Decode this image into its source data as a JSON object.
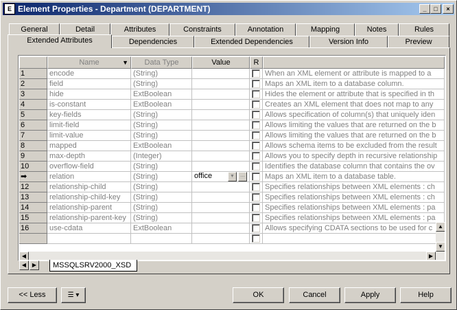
{
  "window": {
    "app_icon": "E",
    "title": "Element Properties - Department (DEPARTMENT)",
    "minimize_glyph": "_",
    "maximize_glyph": "□",
    "close_glyph": "×"
  },
  "tabs_row1": [
    "General",
    "Detail",
    "Attributes",
    "Constraints",
    "Annotation",
    "Mapping",
    "Notes",
    "Rules"
  ],
  "tabs_row2": [
    "Extended Attributes",
    "Dependencies",
    "Extended Dependencies",
    "Version Info",
    "Preview"
  ],
  "active_tab": "Extended Attributes",
  "grid": {
    "headers": {
      "name": "Name",
      "data_type": "Data Type",
      "value": "Value",
      "r": "R"
    },
    "rows": [
      {
        "num": "1",
        "name": "encode",
        "type": "(String)",
        "value": "",
        "desc": "When an XML element or attribute is mapped to a"
      },
      {
        "num": "2",
        "name": "field",
        "type": "(String)",
        "value": "",
        "desc": "Maps an XML item to a database column."
      },
      {
        "num": "3",
        "name": "hide",
        "type": "ExtBoolean",
        "value": "",
        "desc": "Hides the element or attribute that is specified in th"
      },
      {
        "num": "4",
        "name": "is-constant",
        "type": "ExtBoolean",
        "value": "",
        "desc": "Creates an XML element that does not map to any"
      },
      {
        "num": "5",
        "name": "key-fields",
        "type": "(String)",
        "value": "",
        "desc": "Allows specification of column(s) that uniquely iden"
      },
      {
        "num": "6",
        "name": "limit-field",
        "type": "(String)",
        "value": "",
        "desc": "Allows limiting the values that are returned on the b"
      },
      {
        "num": "7",
        "name": "limit-value",
        "type": "(String)",
        "value": "",
        "desc": "Allows limiting the values that are returned on the b"
      },
      {
        "num": "8",
        "name": "mapped",
        "type": "ExtBoolean",
        "value": "",
        "desc": "Allows schema items to be excluded from the result"
      },
      {
        "num": "9",
        "name": "max-depth",
        "type": "(Integer)",
        "value": "",
        "desc": "Allows you to specify depth in recursive relationship"
      },
      {
        "num": "10",
        "name": "overflow-field",
        "type": "(String)",
        "value": "",
        "desc": "Identifies the database column that contains the ov"
      },
      {
        "num": "➡",
        "name": "relation",
        "type": "(String)",
        "value": "office",
        "desc": "Maps an XML item to a database table."
      },
      {
        "num": "12",
        "name": "relationship-child",
        "type": "(String)",
        "value": "",
        "desc": "Specifies relationships between XML elements : ch"
      },
      {
        "num": "13",
        "name": "relationship-child-key",
        "type": "(String)",
        "value": "",
        "desc": "Specifies relationships between XML elements : ch"
      },
      {
        "num": "14",
        "name": "relationship-parent",
        "type": "(String)",
        "value": "",
        "desc": "Specifies relationships between XML elements : pa"
      },
      {
        "num": "15",
        "name": "relationship-parent-key",
        "type": "(String)",
        "value": "",
        "desc": "Specifies relationships between XML elements : pa"
      },
      {
        "num": "16",
        "name": "use-cdata",
        "type": "ExtBoolean",
        "value": "",
        "desc": "Allows specifying CDATA sections to be used for c"
      },
      {
        "num": "",
        "name": "",
        "type": "",
        "value": "",
        "desc": ""
      }
    ],
    "ellipsis_glyph": "...",
    "sheet_tab": "MSSQLSRV2000_XSD"
  },
  "footer": {
    "less": "<< Less",
    "ok": "OK",
    "cancel": "Cancel",
    "apply": "Apply",
    "help": "Help"
  },
  "icons": {
    "title": "app-icon",
    "sort": "sort-down-icon",
    "menu": "list-menu-icon"
  }
}
